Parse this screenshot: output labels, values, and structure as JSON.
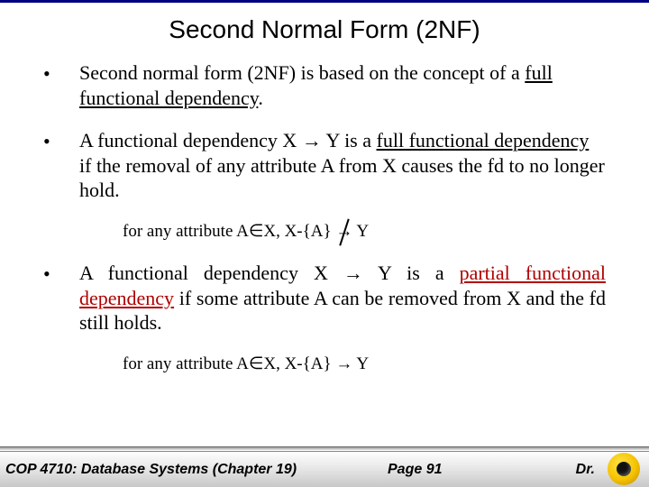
{
  "title": "Second Normal Form (2NF)",
  "bullets": {
    "first": {
      "pre": "Second normal form (2NF) is based on the concept of a ",
      "em": "full functional dependency",
      "post": "."
    },
    "second": {
      "pre": "A functional dependency X → Y is a ",
      "em": "full functional dependency",
      "post": " if the removal of any attribute A from X causes the fd to no longer hold."
    },
    "sub1": {
      "pre": "for any attribute A∈X, X-{A} ",
      "arrow": "→",
      "post": " Y"
    },
    "third": {
      "pre": "A functional dependency X → Y is a ",
      "em": "partial functional dependency",
      "post": " if some attribute A can be removed from X and the fd still holds."
    },
    "sub2": "for any attribute A∈X, X-{A} → Y"
  },
  "footer": {
    "course": "COP 4710: Database Systems  (Chapter 19)",
    "page": "Page 91",
    "author": "Dr."
  }
}
